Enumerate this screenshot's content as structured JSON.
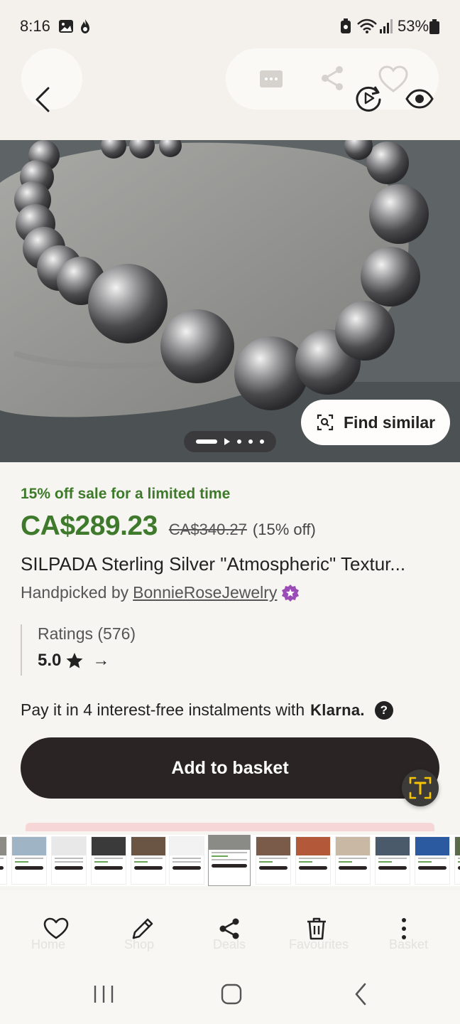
{
  "status_bar": {
    "time": "8:16",
    "battery": "53%"
  },
  "ghost_tabs": [
    "Home",
    "Shop",
    "Deals",
    "Favourites",
    "Basket"
  ],
  "hero": {
    "find_similar_label": "Find similar"
  },
  "product": {
    "sale_text": "15% off sale for a limited time",
    "price": "CA$289.23",
    "original_price": "CA$340.27",
    "discount": "(15% off)",
    "title": "SILPADA Sterling Silver \"Atmospheric\" Textur...",
    "seller_prefix": "Handpicked by",
    "seller_name": "BonnieRoseJewelry"
  },
  "ratings": {
    "label": "Ratings (576)",
    "score": "5.0",
    "arrow": "→"
  },
  "klarna": {
    "text": "Pay it in 4 interest-free instalments with",
    "brand": "Klarna."
  },
  "add_to_basket": "Add to basket",
  "colors": {
    "sale_green": "#3f7a2c",
    "button_dark": "#2b2424"
  }
}
